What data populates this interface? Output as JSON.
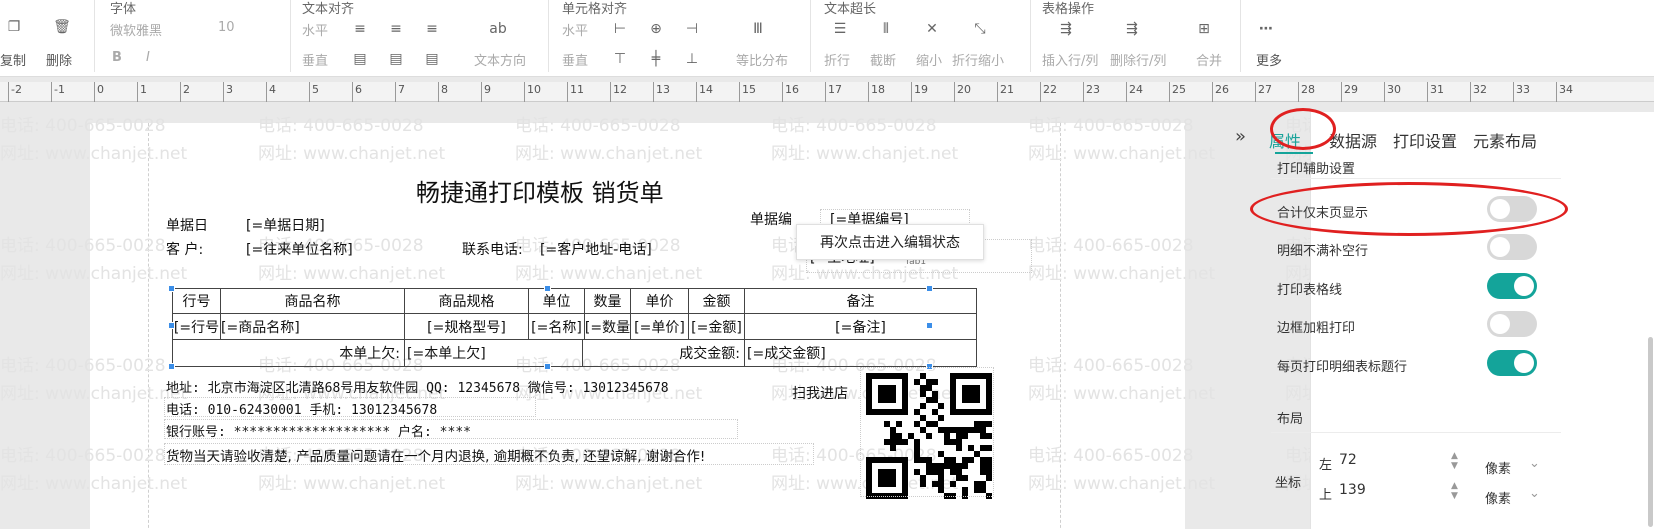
{
  "toolbar": {
    "groups": {
      "font": "字体",
      "align": "文本对齐",
      "cell_align": "单元格对齐",
      "overflow": "文本超长",
      "table_ops": "表格操作"
    },
    "font_name": "微软雅黑",
    "font_size": "10",
    "copy": "复制",
    "delete": "删除",
    "bold": "B",
    "italic": "I",
    "horizontal": "水平",
    "vertical": "垂直",
    "text_direction": "文本方向",
    "cell_horizontal": "水平",
    "cell_vertical": "垂直",
    "distribute": "等比分布",
    "wrap": "折行",
    "truncate": "截断",
    "shrink": "缩小",
    "wrap_shrink": "折行缩小",
    "insert_rowcol": "插入行/列",
    "delete_rowcol": "删除行/列",
    "merge": "合并",
    "more": "更多"
  },
  "ruler": [
    "-2",
    "-1",
    "0",
    "1",
    "2",
    "3",
    "4",
    "5",
    "6",
    "7",
    "8",
    "9",
    "10",
    "11",
    "12",
    "13",
    "14",
    "15",
    "16",
    "17",
    "18",
    "19",
    "20",
    "21",
    "22",
    "23",
    "24",
    "25",
    "26",
    "27",
    "28",
    "29",
    "30",
    "31",
    "32",
    "33",
    "34"
  ],
  "watermark": {
    "phone": "电话: 400-665-0028",
    "url": "网址: www.chanjet.net"
  },
  "document": {
    "title": "畅捷通打印模板 销货单",
    "doc_date_label": "单据日",
    "doc_date_value": "[=单据日期]",
    "doc_no_label": "单据编",
    "doc_no_value": "[=单据编号]",
    "customer_label": "客  户:",
    "customer_value": "[=往来单位名称]",
    "contact_label": "联系电话:",
    "contact_value": "[=客户地址-电话]",
    "address_field_value": "[=主地址]",
    "fab_label": "fab1",
    "table": {
      "headers": [
        "行号",
        "商品名称",
        "商品规格",
        "单位",
        "数量",
        "单价",
        "金额",
        "备注"
      ],
      "row": [
        "[=行号",
        "[=商品名称]",
        "[=规格型号]",
        "[=名称]",
        "[=数量",
        "[=单价]",
        "[=金额]",
        "[=备注]"
      ],
      "summary_label": "本单上欠:",
      "summary_value": "[=本单上欠]",
      "amount_label": "成交金额:",
      "amount_value": "[=成交金额]"
    },
    "address_line": "地址: 北京市海淀区北清路68号用友软件园 QQ: 12345678 微信号: 13012345678",
    "phone_line": "电话: 010-62430001 手机: 13012345678",
    "bank_line": "银行账号: ******************** 户名: ****",
    "notice_line": "货物当天请验收清楚, 产品质量问题请在一个月内退换, 逾期概不负责, 还望谅解, 谢谢合作!",
    "scan_label": "扫我进店"
  },
  "tooltip": "再次点击进入编辑状态",
  "panel": {
    "collapse": "»",
    "tabs": [
      "属性",
      "数据源",
      "打印设置",
      "元素布局"
    ],
    "section_print": "打印辅助设置",
    "options": [
      {
        "label": "合计仅末页显示",
        "on": false
      },
      {
        "label": "明细不满补空行",
        "on": false
      },
      {
        "label": "打印表格线",
        "on": true
      },
      {
        "label": "边框加粗打印",
        "on": false
      },
      {
        "label": "每页打印明细表标题行",
        "on": true
      }
    ],
    "section_layout": "布局",
    "coord_label": "坐标",
    "left_label": "左",
    "left_value": "72",
    "top_label": "上",
    "top_value": "139",
    "unit": "像素"
  },
  "colors": {
    "accent": "#14a49a",
    "annotation": "#e02020",
    "selection": "#3b8ee8"
  }
}
